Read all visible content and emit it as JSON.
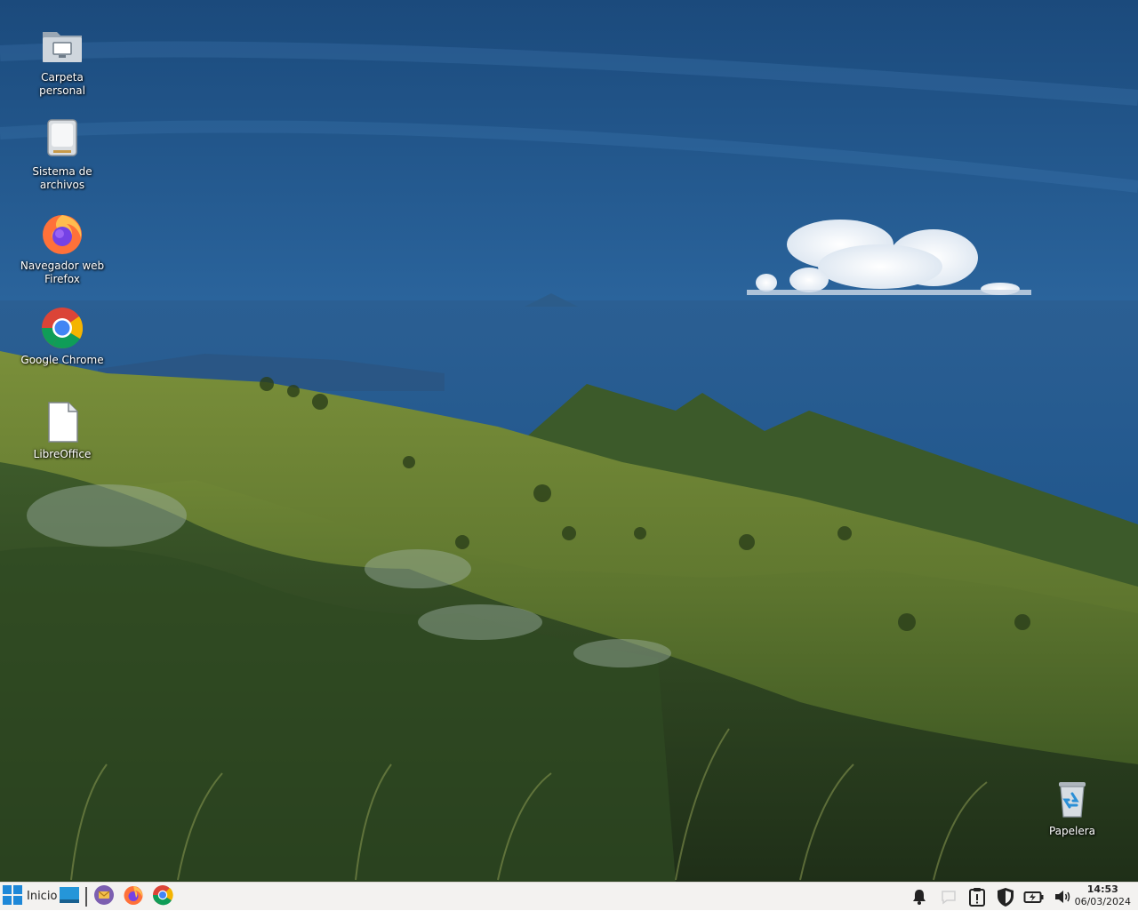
{
  "desktop": {
    "icons": [
      {
        "label_line1": "Carpeta",
        "label_line2": "personal",
        "icon": "home-folder-icon"
      },
      {
        "label_line1": "Sistema de",
        "label_line2": "archivos",
        "icon": "drive-icon"
      },
      {
        "label_line1": "Navegador web",
        "label_line2": "Firefox",
        "icon": "firefox-icon"
      },
      {
        "label_line1": "Google Chrome",
        "label_line2": "",
        "icon": "chrome-icon"
      },
      {
        "label_line1": "LibreOffice",
        "label_line2": "",
        "icon": "document-icon"
      }
    ],
    "trash": {
      "label": "Papelera",
      "icon": "trash-icon"
    }
  },
  "taskbar": {
    "start_label": "Inicio",
    "launchers": [
      "show-desktop-icon",
      "mail-icon",
      "firefox-icon",
      "chrome-icon"
    ],
    "tray": [
      "notifications-icon",
      "chat-icon",
      "clipboard-icon",
      "shield-icon",
      "battery-icon",
      "volume-icon"
    ],
    "clock": {
      "time": "14:53",
      "date": "06/03/2024"
    }
  },
  "colors": {
    "sky_top": "#1d4d80",
    "sky_horizon": "#3a78b0",
    "grass": "#5f7a2c",
    "taskbar_bg": "#f3f2f0",
    "accent_blue": "#1e88d8"
  }
}
